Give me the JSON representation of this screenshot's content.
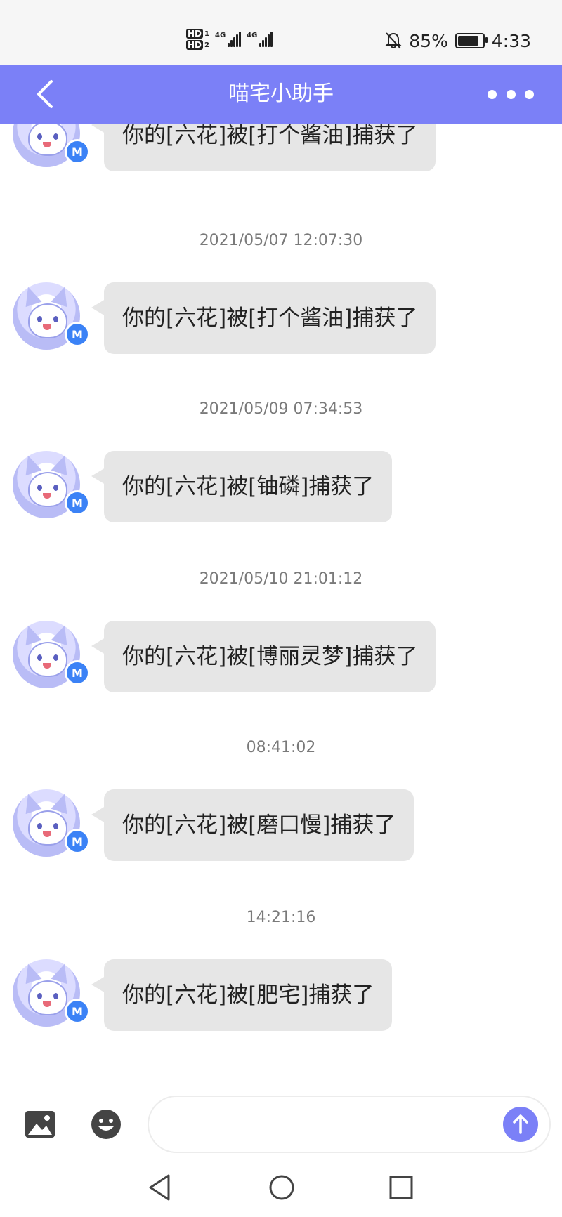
{
  "status_bar": {
    "sim1_hd": "HD",
    "sim1_num": "1",
    "sim2_hd": "HD",
    "sim2_num": "2",
    "net1": "4G",
    "net2": "4G",
    "battery_percent": "85%",
    "battery_level": 0.85,
    "time": "4:33",
    "icons": [
      "bell-off-icon",
      "battery-icon",
      "signal-icon"
    ]
  },
  "header": {
    "title": "喵宅小助手",
    "back_icon": "chevron-left-icon",
    "more_icon": "more-dots-icon"
  },
  "messages": [
    {
      "timestamp": "",
      "text": "你的[六花]被[打个酱油]捕获了"
    },
    {
      "timestamp": "2021/05/07 12:07:30",
      "text": "你的[六花]被[打个酱油]捕获了"
    },
    {
      "timestamp": "2021/05/09 07:34:53",
      "text": "你的[六花]被[铀磷]捕获了"
    },
    {
      "timestamp": "2021/05/10 21:01:12",
      "text": "你的[六花]被[博丽灵梦]捕获了"
    },
    {
      "timestamp": "08:41:02",
      "text": "你的[六花]被[磨口慢]捕获了"
    },
    {
      "timestamp": "14:21:16",
      "text": "你的[六花]被[肥宅]捕获了"
    }
  ],
  "avatar_badge": "M",
  "input_bar": {
    "placeholder": "",
    "image_icon": "image-icon",
    "emoji_icon": "emoji-icon",
    "send_icon": "arrow-up-icon"
  },
  "nav_bar": {
    "icons": [
      "triangle-back-icon",
      "circle-home-icon",
      "square-recent-icon"
    ]
  },
  "colors": {
    "accent": "#7b80f7",
    "bubble": "#e6e6e6",
    "timestamp": "#7a7a7a",
    "badge": "#3b82f6"
  }
}
